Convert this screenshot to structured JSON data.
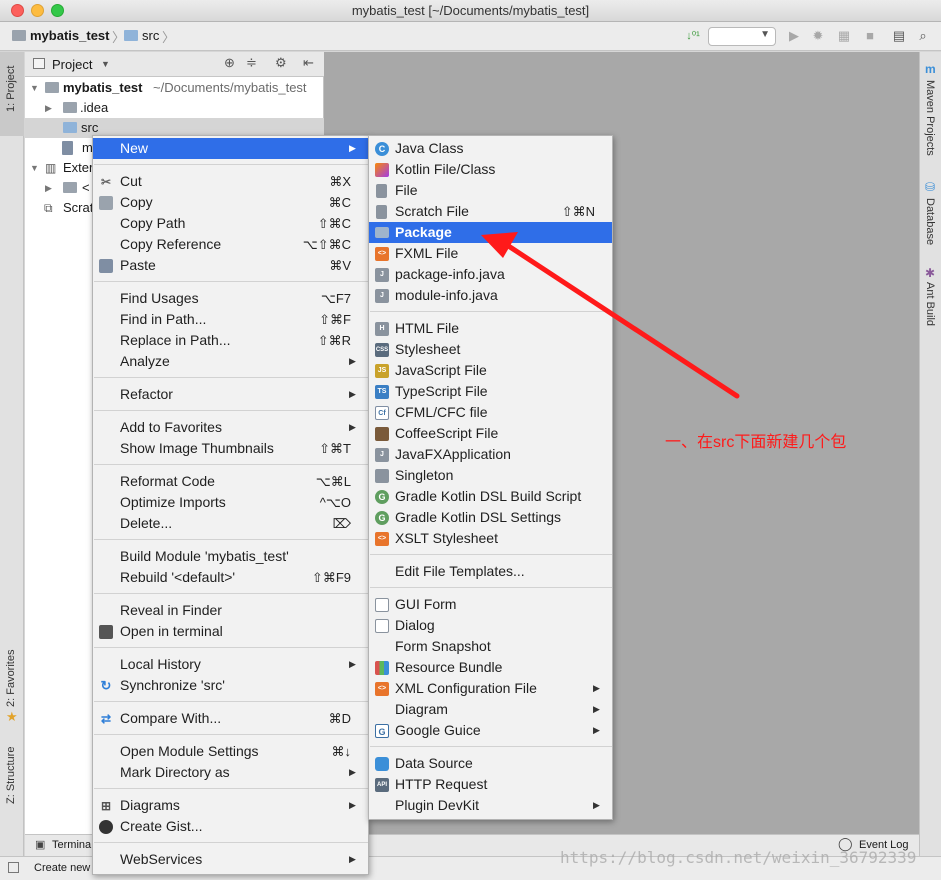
{
  "window": {
    "title": "mybatis_test [~/Documents/mybatis_test]"
  },
  "breadcrumb": [
    {
      "label": "mybatis_test"
    },
    {
      "label": "src"
    }
  ],
  "toolbar": {
    "run_config": ""
  },
  "left_stripe": {
    "tabs": [
      "1: Project",
      "2: Favorites",
      "Z: Structure"
    ]
  },
  "right_stripe": {
    "tabs": [
      "Maven Projects",
      "Database",
      "Ant Build"
    ]
  },
  "project_panel": {
    "header_label": "Project",
    "tree": [
      {
        "label": "mybatis_test",
        "path": "~/Documents/mybatis_test"
      },
      {
        "label": ".idea"
      },
      {
        "label": "src"
      },
      {
        "label": "m"
      },
      {
        "label": "Exter"
      },
      {
        "label": "<"
      },
      {
        "label": "Scrat"
      }
    ]
  },
  "context_menu": {
    "items": [
      {
        "label": "New",
        "shortcut": "",
        "submenu": true,
        "icon": ""
      },
      {
        "label": "Cut",
        "shortcut": "⌘X",
        "icon": "scissors-icon"
      },
      {
        "label": "Copy",
        "shortcut": "⌘C",
        "icon": "copy-icon"
      },
      {
        "label": "Copy Path",
        "shortcut": "⇧⌘C",
        "icon": ""
      },
      {
        "label": "Copy Reference",
        "shortcut": "⌥⇧⌘C",
        "icon": ""
      },
      {
        "label": "Paste",
        "shortcut": "⌘V",
        "icon": "paste-icon"
      },
      {
        "label": "Find Usages",
        "shortcut": "⌥F7",
        "icon": ""
      },
      {
        "label": "Find in Path...",
        "shortcut": "⇧⌘F",
        "icon": ""
      },
      {
        "label": "Replace in Path...",
        "shortcut": "⇧⌘R",
        "icon": ""
      },
      {
        "label": "Analyze",
        "shortcut": "",
        "submenu": true,
        "icon": ""
      },
      {
        "label": "Refactor",
        "shortcut": "",
        "submenu": true,
        "icon": ""
      },
      {
        "label": "Add to Favorites",
        "shortcut": "",
        "submenu": true,
        "icon": ""
      },
      {
        "label": "Show Image Thumbnails",
        "shortcut": "⇧⌘T",
        "icon": ""
      },
      {
        "label": "Reformat Code",
        "shortcut": "⌥⌘L",
        "icon": ""
      },
      {
        "label": "Optimize Imports",
        "shortcut": "^⌥O",
        "icon": ""
      },
      {
        "label": "Delete...",
        "shortcut": "⌦",
        "icon": ""
      },
      {
        "label": "Build Module 'mybatis_test'",
        "shortcut": "",
        "icon": ""
      },
      {
        "label": "Rebuild '<default>'",
        "shortcut": "⇧⌘F9",
        "icon": ""
      },
      {
        "label": "Reveal in Finder",
        "shortcut": "",
        "icon": ""
      },
      {
        "label": "Open in terminal",
        "shortcut": "",
        "icon": "terminal-icon"
      },
      {
        "label": "Local History",
        "shortcut": "",
        "submenu": true,
        "icon": ""
      },
      {
        "label": "Synchronize 'src'",
        "shortcut": "",
        "icon": "sync-icon"
      },
      {
        "label": "Compare With...",
        "shortcut": "⌘D",
        "icon": "compare-icon"
      },
      {
        "label": "Open Module Settings",
        "shortcut": "⌘↓",
        "icon": ""
      },
      {
        "label": "Mark Directory as",
        "shortcut": "",
        "submenu": true,
        "icon": ""
      },
      {
        "label": "Diagrams",
        "shortcut": "",
        "submenu": true,
        "icon": "diagram-icon"
      },
      {
        "label": "Create Gist...",
        "shortcut": "",
        "icon": "github-icon"
      },
      {
        "label": "WebServices",
        "shortcut": "",
        "submenu": true,
        "icon": ""
      }
    ]
  },
  "new_submenu": {
    "items": [
      {
        "label": "Java Class",
        "shortcut": "",
        "icon": "java-class-icon"
      },
      {
        "label": "Kotlin File/Class",
        "shortcut": "",
        "icon": "kotlin-icon"
      },
      {
        "label": "File",
        "shortcut": "",
        "icon": "file-icon"
      },
      {
        "label": "Scratch File",
        "shortcut": "⇧⌘N",
        "icon": "scratch-file-icon"
      },
      {
        "label": "Package",
        "shortcut": "",
        "icon": "package-icon"
      },
      {
        "label": "FXML File",
        "shortcut": "",
        "icon": "fxml-icon"
      },
      {
        "label": "package-info.java",
        "shortcut": "",
        "icon": "java-file-icon"
      },
      {
        "label": "module-info.java",
        "shortcut": "",
        "icon": "java-file-icon"
      },
      {
        "label": "HTML File",
        "shortcut": "",
        "icon": "html-icon"
      },
      {
        "label": "Stylesheet",
        "shortcut": "",
        "icon": "css-icon"
      },
      {
        "label": "JavaScript File",
        "shortcut": "",
        "icon": "js-icon"
      },
      {
        "label": "TypeScript File",
        "shortcut": "",
        "icon": "ts-icon"
      },
      {
        "label": "CFML/CFC file",
        "shortcut": "",
        "icon": "cf-icon"
      },
      {
        "label": "CoffeeScript File",
        "shortcut": "",
        "icon": "coffee-icon"
      },
      {
        "label": "JavaFXApplication",
        "shortcut": "",
        "icon": "javafx-icon"
      },
      {
        "label": "Singleton",
        "shortcut": "",
        "icon": "singleton-icon"
      },
      {
        "label": "Gradle Kotlin DSL Build Script",
        "shortcut": "",
        "icon": "gradle-icon"
      },
      {
        "label": "Gradle Kotlin DSL Settings",
        "shortcut": "",
        "icon": "gradle-icon"
      },
      {
        "label": "XSLT Stylesheet",
        "shortcut": "",
        "icon": "xslt-icon"
      },
      {
        "label": "Edit File Templates...",
        "shortcut": "",
        "icon": ""
      },
      {
        "label": "GUI Form",
        "shortcut": "",
        "icon": "gui-form-icon"
      },
      {
        "label": "Dialog",
        "shortcut": "",
        "icon": "dialog-icon"
      },
      {
        "label": "Form Snapshot",
        "shortcut": "",
        "icon": ""
      },
      {
        "label": "Resource Bundle",
        "shortcut": "",
        "icon": "resource-bundle-icon"
      },
      {
        "label": "XML Configuration File",
        "shortcut": "",
        "submenu": true,
        "icon": "xml-icon"
      },
      {
        "label": "Diagram",
        "shortcut": "",
        "submenu": true,
        "icon": ""
      },
      {
        "label": "Google Guice",
        "shortcut": "",
        "submenu": true,
        "icon": "guice-icon"
      },
      {
        "label": "Data Source",
        "shortcut": "",
        "icon": "database-icon"
      },
      {
        "label": "HTTP Request",
        "shortcut": "",
        "icon": "api-icon"
      },
      {
        "label": "Plugin DevKit",
        "shortcut": "",
        "submenu": true,
        "icon": ""
      }
    ]
  },
  "bottom": {
    "terminal_tab": "Termina",
    "event_log": "Event Log",
    "status_text": "Create new"
  },
  "annotation": {
    "text": "一、在src下面新建几个包",
    "color": "#ff1a1a"
  },
  "watermark": {
    "text": "https://blog.csdn.net/weixin_36792339"
  },
  "colors": {
    "selection": "#2f6ee8",
    "editor_bg": "#a8a8a8"
  }
}
